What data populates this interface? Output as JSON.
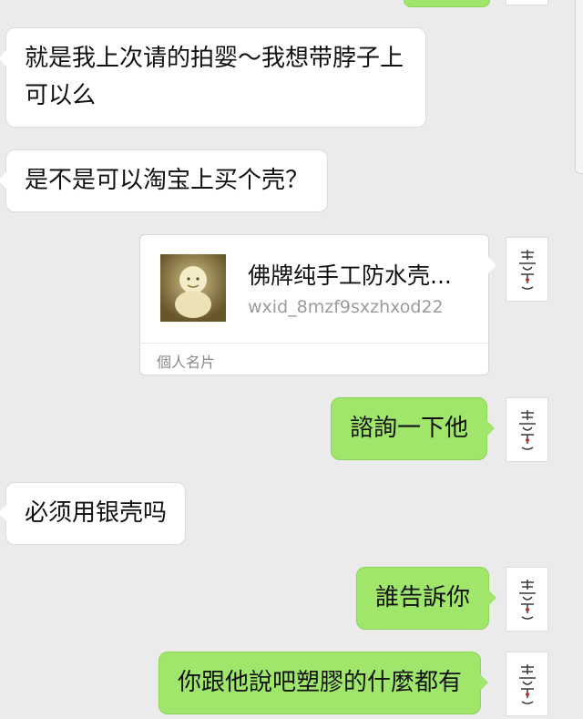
{
  "messages": [
    {
      "side": "left",
      "text": "就是我上次请的拍婴～我想带脖子上可以么"
    },
    {
      "side": "left",
      "text": "是不是可以淘宝上买个壳？"
    },
    {
      "side": "right",
      "type": "contact_card",
      "card": {
        "name": "佛牌纯手工防水壳...",
        "id": "wxid_8mzf9sxzhxod22",
        "footer": "個人名片"
      }
    },
    {
      "side": "right",
      "text": "諮詢一下他"
    },
    {
      "side": "left",
      "text": "必须用银壳吗"
    },
    {
      "side": "right",
      "text": "誰告訴你"
    },
    {
      "side": "right",
      "text": "你跟他說吧塑膠的什麼都有"
    }
  ],
  "colors": {
    "background": "#ebebeb",
    "incoming_bubble": "#ffffff",
    "outgoing_bubble": "#9fe66a"
  },
  "icons": {
    "avatar": "calligraphy-avatar-icon",
    "card_thumbnail": "buddha-amulet-thumbnail"
  }
}
